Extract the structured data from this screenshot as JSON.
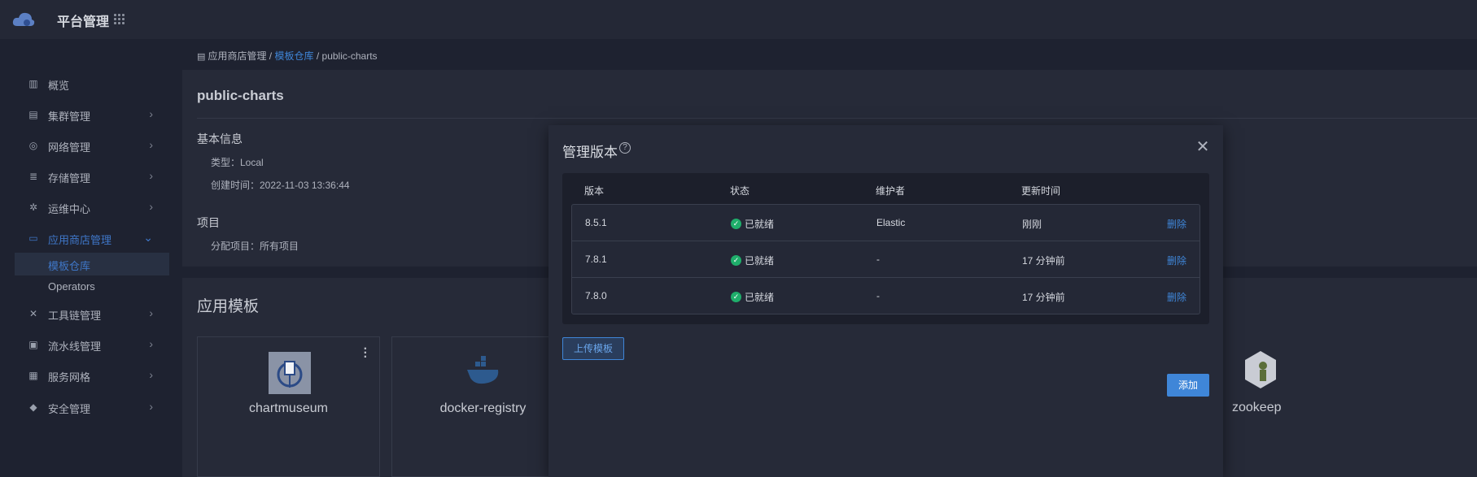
{
  "app": {
    "title": "平台管理",
    "grid_icon": "apps-grid-icon",
    "logo": "cloud-logo-icon"
  },
  "sidebar": {
    "items": [
      {
        "label": "概览",
        "icon": "bar-chart-icon",
        "glyph": "▥",
        "chev": ""
      },
      {
        "label": "集群管理",
        "icon": "cluster-icon",
        "glyph": "▤",
        "chev": "›"
      },
      {
        "label": "网络管理",
        "icon": "globe-icon",
        "glyph": "◎",
        "chev": "›"
      },
      {
        "label": "存储管理",
        "icon": "database-icon",
        "glyph": "≣",
        "chev": "›"
      },
      {
        "label": "运维中心",
        "icon": "ops-icon",
        "glyph": "✲",
        "chev": "›"
      },
      {
        "label": "应用商店管理",
        "icon": "folder-icon",
        "glyph": "▭",
        "chev": "⌄"
      },
      {
        "label": "工具链管理",
        "icon": "tools-icon",
        "glyph": "✕",
        "chev": "›"
      },
      {
        "label": "流水线管理",
        "icon": "pipeline-icon",
        "glyph": "▣",
        "chev": "›"
      },
      {
        "label": "服务网格",
        "icon": "mesh-icon",
        "glyph": "▦",
        "chev": "›"
      },
      {
        "label": "安全管理",
        "icon": "shield-icon",
        "glyph": "◆",
        "chev": "›"
      }
    ],
    "sub_items": [
      {
        "label": "模板仓库"
      },
      {
        "label": "Operators"
      }
    ]
  },
  "breadcrumb": {
    "root": "应用商店管理",
    "sep1": " / ",
    "link": "模板仓库",
    "sep2": " / ",
    "current": "public-charts"
  },
  "repo": {
    "title": "public-charts",
    "basic_title": "基本信息",
    "type_text": "类型：Local",
    "created_text": "创建时间：2022-11-03 13:36:44",
    "project_title": "项目",
    "project_text": "分配项目：所有项目"
  },
  "templates": {
    "title": "应用模板",
    "cards": [
      {
        "name": "chartmuseum"
      },
      {
        "name": "docker-registry"
      }
    ],
    "right_name": "zookeep"
  },
  "modal": {
    "title": "管理版本",
    "headers": {
      "version": "版本",
      "status": "状态",
      "maintainer": "维护者",
      "updated": "更新时间"
    },
    "rows": [
      {
        "version": "8.5.1",
        "status": "已就绪",
        "maintainer": "Elastic",
        "updated": "刚刚",
        "action": "删除"
      },
      {
        "version": "7.8.1",
        "status": "已就绪",
        "maintainer": "-",
        "updated": "17 分钟前",
        "action": "删除"
      },
      {
        "version": "7.8.0",
        "status": "已就绪",
        "maintainer": "-",
        "updated": "17 分钟前",
        "action": "删除"
      }
    ],
    "upload_label": "上传模板",
    "add_label": "添加"
  },
  "colors": {
    "accent": "#3f86d8",
    "success": "#1fae6b",
    "background": "#1e2230",
    "panel": "#262a38"
  }
}
